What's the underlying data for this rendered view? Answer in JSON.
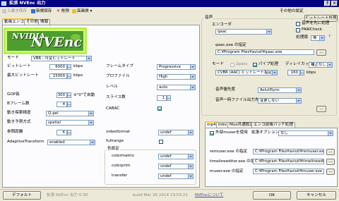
{
  "title": "拡張 NVEnc 出力",
  "window_buttons": {
    "help": "?",
    "close": "✕"
  },
  "toolbar": {
    "overwrite": "上書き保存",
    "new_save": "新規保存",
    "delete": "削除",
    "preset": "高画質",
    "other_settings": "その他の設定",
    "bitrate_calc": "ビットレート計算機"
  },
  "main_tabs": [
    "動画エンコード",
    "その他",
    "情報"
  ],
  "logo": {
    "top": "NVIDIA",
    "main": "NVEnc"
  },
  "video": {
    "mode_label": "モード",
    "mode_value": "VBR - 可変ビットレート",
    "bitrate_label": "ビットレート",
    "bitrate_value": "6000",
    "bitrate_unit": "kbps",
    "maxbitrate_label": "最大ビットレート",
    "maxbitrate_value": "15000",
    "maxbitrate_unit": "kbps",
    "gop_label": "GOP長",
    "gop_value": "300",
    "gop_note": "※\"0\"で自動",
    "bframes_label": "Bフレーム数",
    "bframes_value": "4",
    "me_label": "動き探索精度",
    "me_value": "Q-pel",
    "mvpred_label": "動き予測方式",
    "mvpred_value": "spatial",
    "ref_label": "参照距離",
    "ref_value": "6",
    "adapt_label": "AdaptiveTransform",
    "adapt_value": "enabled",
    "frametype_label": "フレームタイプ",
    "frametype_value": "Progressive",
    "profile_label": "プロファイル",
    "profile_value": "High",
    "level_label": "レベル",
    "level_value": "auto",
    "slices_label": "スライス数",
    "slices_value": "1",
    "cabac_label": "CABAC",
    "videoformat_label": "videoformat",
    "videoformat_value": "undef",
    "fullrange_label": "fullrange",
    "colorspace_label": "色設定",
    "colormatrix_label": "colormatrix",
    "colormatrix_value": "undef",
    "colorprim_label": "colorprim",
    "colorprim_value": "undef",
    "transfer_label": "transfer",
    "transfer_value": "undef"
  },
  "audio": {
    "section_label": "音声",
    "encoder_label": "エンコーダ",
    "encoder_value": "qaac",
    "audio_first_label": "音声を先に処理",
    "fawcheck_label": "FAWCheck",
    "order_label": "処理順",
    "order_value": "後",
    "exe_label": "qaac.exe の指定",
    "exe_path": "C:¥Program Files¥aviutl¥qaac.exe",
    "mode_label": "モード",
    "twopass_label": "2pass",
    "pipe_label": "パイプ処理",
    "delay_label": "ディレイカット",
    "delay_value": "補正なし",
    "mode_value": "CVBR (AAC) ビットレート指定",
    "abitrate_value": "160",
    "abitrate_unit": "kbps",
    "priority_label": "音声優先度",
    "priority_value": "AviutlSync",
    "tempdir_label": "音声一時ファイル出力先",
    "tempdir_value": "変更しない"
  },
  "mux_tabs": [
    "mp4",
    "mkv",
    "Mux共通設定",
    "エンコ前後バッチ処理"
  ],
  "mux": {
    "external_label": "外部muxerを使用",
    "ext_option_label": "拡張オプション",
    "ext_option_value": "なし",
    "remuxer_label": "remuxer.exe の指定",
    "remuxer_path": "C:¥Program Files¥aviutl¥remuxer.exe",
    "timeline_label": "timelineeditor.exe の指定",
    "timeline_path": "C:¥Program Files¥aviutl¥timelineeditor.exe",
    "muxer_label": "muxer.exe の指定",
    "muxer_path": "C:¥Program Files¥aviutl¥muxer.exe"
  },
  "bottom": {
    "default_btn": "デフォルト",
    "version": "拡張 NVEnc 出力 0.00",
    "build": "build Mar 28 2014 23:53:21",
    "link": "NVEncについて",
    "ok": "OK",
    "cancel": "キャンセル"
  },
  "colors": {
    "titlebar": "#000080",
    "logo_green": "#4e9d2f",
    "logo_border": "#b8f04a",
    "panel_bg": "#fcfcfe"
  }
}
